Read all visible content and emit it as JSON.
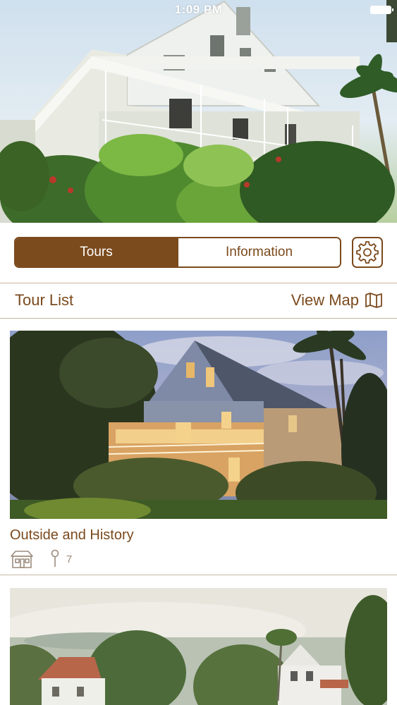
{
  "status_bar": {
    "time": "1:09 PM",
    "battery_icon": "battery-icon"
  },
  "hero": {
    "image": "hero-house-photo"
  },
  "tabs": [
    {
      "label": "Tours",
      "active": true
    },
    {
      "label": "Information",
      "active": false
    }
  ],
  "settings_icon": "gear-icon",
  "tour_list": {
    "title": "Tour List",
    "view_map_label": "View Map",
    "view_map_icon": "map-icon"
  },
  "tours": [
    {
      "title": "Outside and History",
      "stop_count": "7",
      "icons": [
        "house-icon",
        "pin-icon"
      ]
    },
    {
      "title": "",
      "image": "painting-of-house"
    }
  ],
  "colors": {
    "accent": "#7b4a1d",
    "divider": "#c9b7a2",
    "meta": "#9b8b7b"
  }
}
